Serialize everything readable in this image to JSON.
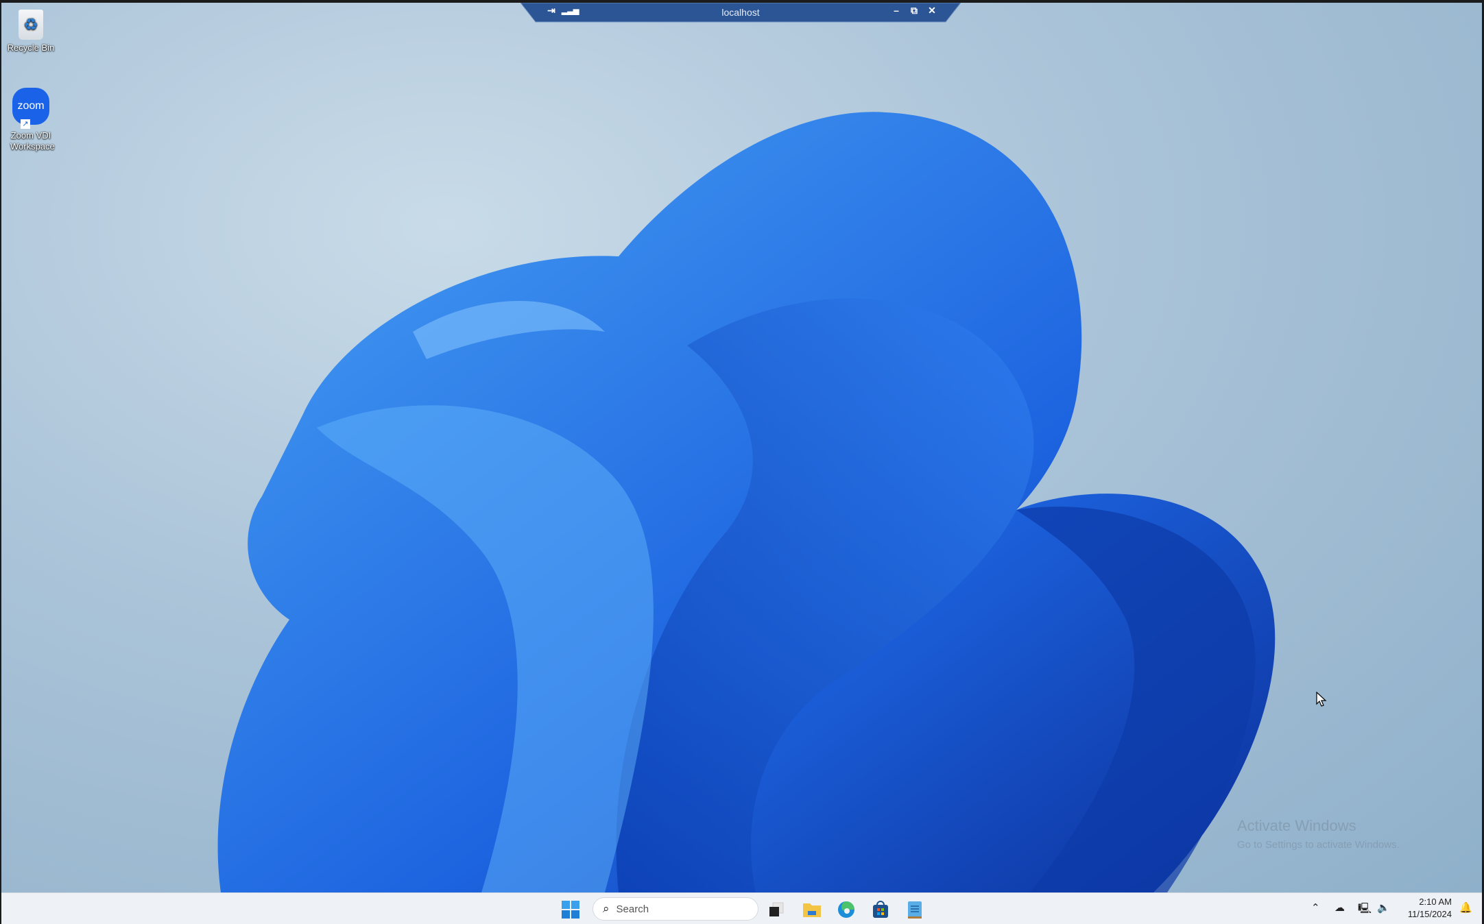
{
  "desktop_icons": [
    {
      "label": "Recycle Bin",
      "icon": "recycle-bin-icon"
    },
    {
      "label": "Zoom VDI Workspace",
      "icon": "zoom-icon",
      "logo_text": "zoom"
    }
  ],
  "rdp_bar": {
    "title": "localhost"
  },
  "watermark": {
    "title": "Activate Windows",
    "subtitle": "Go to Settings to activate Windows."
  },
  "taskbar": {
    "search_placeholder": "Search",
    "apps": [
      "start-icon",
      "task-view-icon",
      "file-explorer-icon",
      "edge-icon",
      "store-icon",
      "notepad-icon"
    ]
  },
  "tray": {
    "time": "2:10 AM",
    "date": "11/15/2024"
  },
  "colors": {
    "accent": "#1a5fd6",
    "rdp_bar": "#2c5596"
  }
}
